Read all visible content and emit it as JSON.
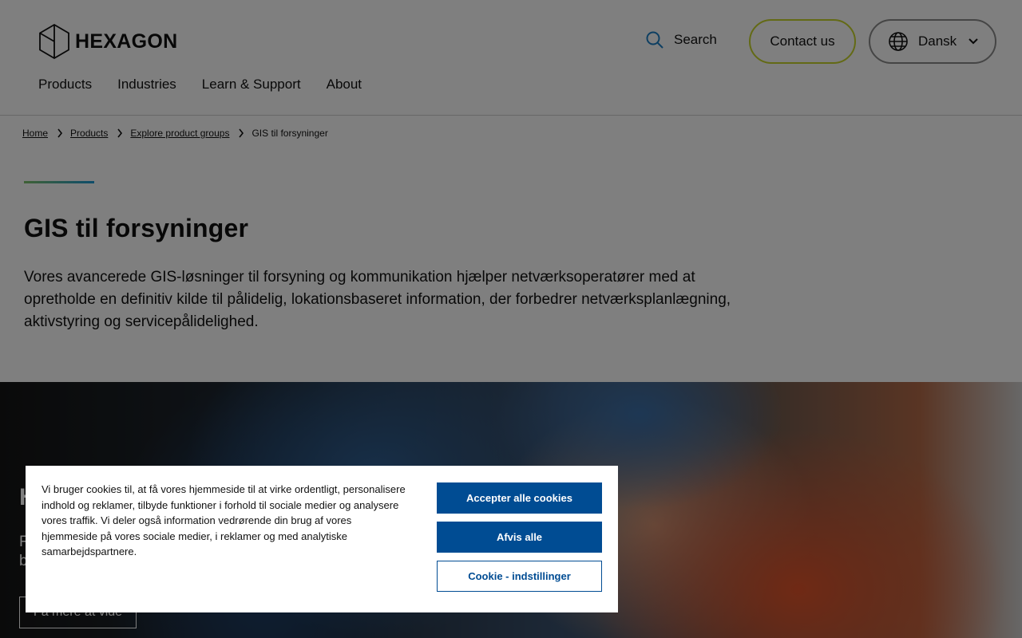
{
  "header": {
    "logo_text": "HEXAGON",
    "search_label": "Search",
    "contact_label": "Contact us",
    "language_label": "Dansk",
    "nav": [
      {
        "label": "Products"
      },
      {
        "label": "Industries"
      },
      {
        "label": "Learn & Support"
      },
      {
        "label": "About"
      }
    ]
  },
  "breadcrumb": {
    "items": [
      {
        "label": "Home"
      },
      {
        "label": "Products"
      },
      {
        "label": "Explore product groups"
      }
    ],
    "current": "GIS til forsyninger"
  },
  "hero": {
    "title": "GIS til forsyninger",
    "intro": "Vores avancerede GIS-løsninger til forsyning og kommunikation hjælper netværksoperatører med at opretholde en definitiv kilde til pålidelig, lokationsbaseret information, der forbedrer netværksplanlægning, aktivstyring og servicepålidelighed."
  },
  "band": {
    "title_fragment": "H",
    "subtitle_fragment_1": "F",
    "subtitle_fragment_2": "b",
    "cta_label": "Få mere at vide"
  },
  "cookie_banner": {
    "text": "Vi bruger cookies til, at få vores hjemmeside til at virke ordentligt, personalisere indhold og reklamer, tilbyde funktioner i forhold til sociale medier og analysere vores traffik. Vi deler også information vedrørende din brug af vores hjemmeside på vores sociale medier, i reklamer og med analytiske samarbejdspartnere.",
    "accept_label": "Accepter alle cookies",
    "reject_label": "Afvis alle",
    "settings_label": "Cookie - indstillinger"
  },
  "colors": {
    "brand_blue": "#004c93",
    "contact_border": "#c6d42b",
    "accent_gradient_start": "#7fc26b",
    "accent_gradient_end": "#1d9ad6"
  },
  "icons": {
    "logo": "hexagon-logo-icon",
    "search": "search-icon",
    "language": "globe-icon",
    "dropdown": "chevron-down-icon",
    "breadcrumb_separator": "chevron-right-icon"
  }
}
